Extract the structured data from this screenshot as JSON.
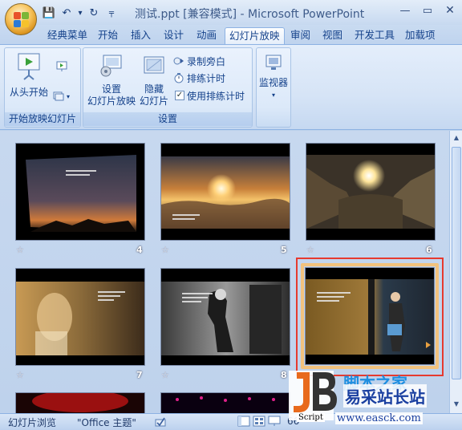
{
  "window": {
    "title": "测试.ppt [兼容模式] - Microsoft PowerPoint"
  },
  "quick_access": [
    {
      "icon": "save-icon",
      "glyph": "💾"
    },
    {
      "icon": "undo-icon",
      "glyph": "↶"
    },
    {
      "icon": "dropdown-icon",
      "glyph": "▾"
    },
    {
      "icon": "redo-icon",
      "glyph": "↻"
    },
    {
      "icon": "customize-icon",
      "glyph": "╤"
    }
  ],
  "window_controls": {
    "minimize": "—",
    "restore": "▭",
    "close": "✕"
  },
  "tabs": [
    "经典菜单",
    "开始",
    "插入",
    "设计",
    "动画",
    "幻灯片放映",
    "审阅",
    "视图",
    "开发工具",
    "加载项"
  ],
  "active_tab": "幻灯片放映",
  "ribbon": {
    "group_start": {
      "label": "开始放映幻灯片",
      "from_start": "从头开始"
    },
    "group_setup": {
      "label": "设置",
      "setup_show": [
        "设置",
        "幻灯片放映"
      ],
      "hide_slide": [
        "隐藏",
        "幻灯片"
      ],
      "record_narration": "录制旁白",
      "rehearse_timings": "排练计时",
      "use_rehearsed_timings": "使用排练计时",
      "use_rehearsed_checked": true
    },
    "group_monitor": {
      "label": "监视器"
    }
  },
  "slides": [
    {
      "number": "4"
    },
    {
      "number": "5"
    },
    {
      "number": "6"
    },
    {
      "number": "7"
    },
    {
      "number": "8"
    },
    {
      "number": ""
    }
  ],
  "status_bar": {
    "view": "幻灯片浏览",
    "theme": "\"Office 主题\"",
    "zoom": "66"
  },
  "watermark": {
    "logo_letters": "JB",
    "script_label": "Script",
    "site_cn": "脚本之家",
    "site_name": "易采站长站",
    "url": "www.easck.com"
  },
  "colors": {
    "ribbon_text": "#15428b",
    "selection_border": "#e63a2f",
    "selection_frame": "#f2c27d"
  }
}
